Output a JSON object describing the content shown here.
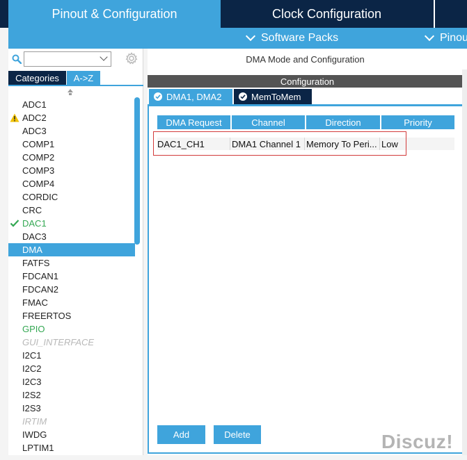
{
  "top_tabs": {
    "pinout": "Pinout & Configuration",
    "clock": "Clock Configuration"
  },
  "sub_bar": {
    "software_packs": "Software Packs",
    "pinout": "Pinout"
  },
  "left": {
    "search_placeholder": "",
    "sort_categories": "Categories",
    "sort_az": "A->Z",
    "items": [
      {
        "label": "ADC1",
        "state": "normal"
      },
      {
        "label": "ADC2",
        "state": "warning"
      },
      {
        "label": "ADC3",
        "state": "normal"
      },
      {
        "label": "COMP1",
        "state": "normal"
      },
      {
        "label": "COMP2",
        "state": "normal"
      },
      {
        "label": "COMP3",
        "state": "normal"
      },
      {
        "label": "COMP4",
        "state": "normal"
      },
      {
        "label": "CORDIC",
        "state": "normal"
      },
      {
        "label": "CRC",
        "state": "normal"
      },
      {
        "label": "DAC1",
        "state": "enabled"
      },
      {
        "label": "DAC3",
        "state": "normal"
      },
      {
        "label": "DMA",
        "state": "selected"
      },
      {
        "label": "FATFS",
        "state": "normal"
      },
      {
        "label": "FDCAN1",
        "state": "normal"
      },
      {
        "label": "FDCAN2",
        "state": "normal"
      },
      {
        "label": "FMAC",
        "state": "normal"
      },
      {
        "label": "FREERTOS",
        "state": "normal"
      },
      {
        "label": "GPIO",
        "state": "green"
      },
      {
        "label": "GUI_INTERFACE",
        "state": "disabled"
      },
      {
        "label": "I2C1",
        "state": "normal"
      },
      {
        "label": "I2C2",
        "state": "normal"
      },
      {
        "label": "I2C3",
        "state": "normal"
      },
      {
        "label": "I2S2",
        "state": "normal"
      },
      {
        "label": "I2S3",
        "state": "normal"
      },
      {
        "label": "IRTIM",
        "state": "disabled"
      },
      {
        "label": "IWDG",
        "state": "normal"
      },
      {
        "label": "LPTIM1",
        "state": "normal"
      }
    ]
  },
  "right": {
    "mode_title": "DMA Mode and Configuration",
    "config_label": "Configuration",
    "tabs": [
      "DMA1, DMA2",
      "MemToMem"
    ],
    "table": {
      "headers": [
        "DMA Request",
        "Channel",
        "Direction",
        "Priority"
      ],
      "rows": [
        [
          "DAC1_CH1",
          "DMA1 Channel 1",
          "Memory To Peri...",
          "Low"
        ]
      ]
    },
    "add_label": "Add",
    "delete_label": "Delete"
  },
  "watermark": "Discuz!",
  "colors": {
    "accent": "#3fa4dc",
    "dark_navy": "#0b2546",
    "enabled_green": "#34a853",
    "warning_yellow": "#f2c200",
    "highlight_red": "#d23a3a"
  }
}
